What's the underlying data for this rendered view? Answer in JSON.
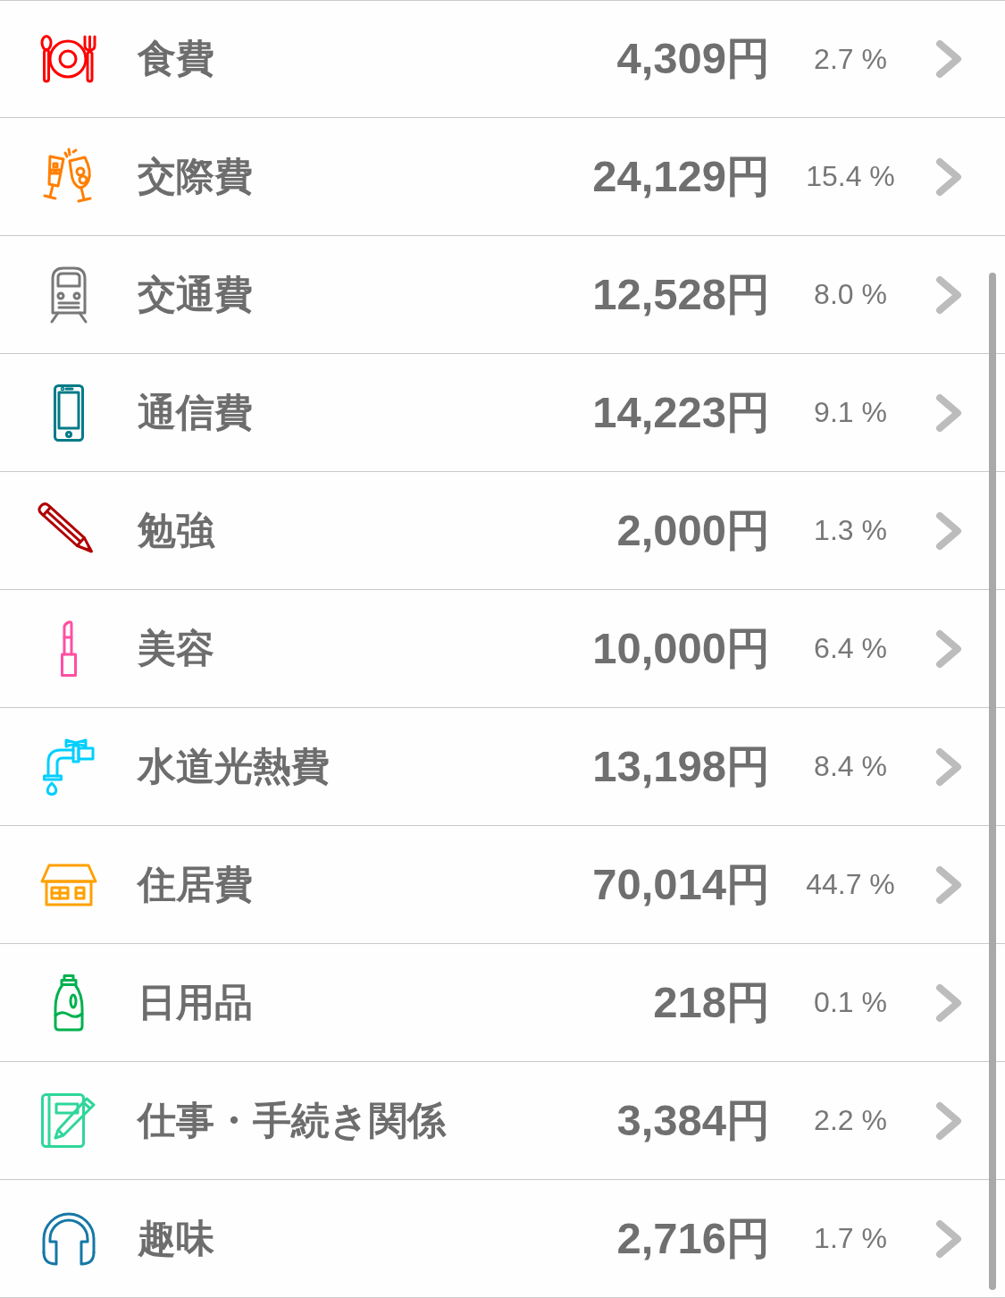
{
  "categories": [
    {
      "kind": "cutlery",
      "color": "#ff0000",
      "label": "食費",
      "amount": "4,309円",
      "percent": "2.7 %"
    },
    {
      "kind": "toast",
      "color": "#ff7f00",
      "label": "交際費",
      "amount": "24,129円",
      "percent": "15.4 %"
    },
    {
      "kind": "train",
      "color": "#787878",
      "label": "交通費",
      "amount": "12,528円",
      "percent": "8.0 %"
    },
    {
      "kind": "phone",
      "color": "#007a87",
      "label": "通信費",
      "amount": "14,223円",
      "percent": "9.1 %"
    },
    {
      "kind": "pencil",
      "color": "#b00000",
      "label": "勉強",
      "amount": "2,000円",
      "percent": "1.3 %"
    },
    {
      "kind": "lipstick",
      "color": "#ff4fa3",
      "label": "美容",
      "amount": "10,000円",
      "percent": "6.4 %"
    },
    {
      "kind": "faucet",
      "color": "#00cfff",
      "label": "水道光熱費",
      "amount": "13,198円",
      "percent": "8.4 %"
    },
    {
      "kind": "house",
      "color": "#ffa000",
      "label": "住居費",
      "amount": "70,014円",
      "percent": "44.7 %"
    },
    {
      "kind": "bottle",
      "color": "#00b04f",
      "label": "日用品",
      "amount": "218円",
      "percent": "0.1 %"
    },
    {
      "kind": "notebook",
      "color": "#2fd69a",
      "label": "仕事・手続き関係",
      "amount": "3,384円",
      "percent": "2.2 %"
    },
    {
      "kind": "headphones",
      "color": "#1677a6",
      "label": "趣味",
      "amount": "2,716円",
      "percent": "1.7 %"
    }
  ]
}
